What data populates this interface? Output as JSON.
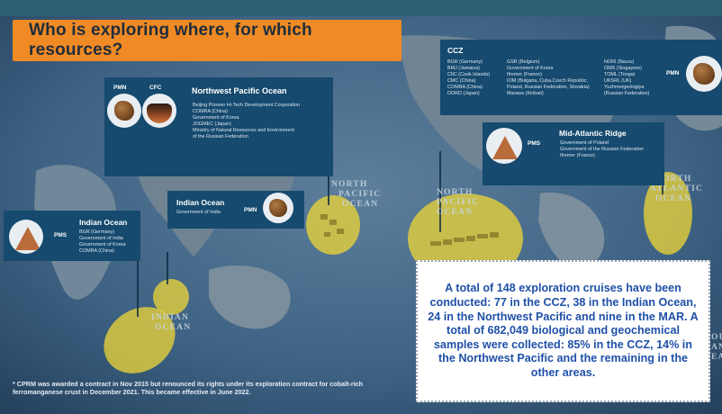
{
  "title": "Who is exploring where, for which resources?",
  "colors": {
    "accent_orange": "#ef8a24",
    "card_blue": "#164a6e",
    "exploration_area_yellow": "#e8d23a",
    "info_text_blue": "#1f50a8"
  },
  "cards": {
    "npo": {
      "title": "Northwest Pacific Ocean",
      "tag1": "PMN",
      "tag2": "CFC",
      "contractors": [
        "Beijing Pioneer Hi-Tech Development Corporation",
        "COMRA (China)",
        "Government of Korea",
        "JOGMEC (Japan)",
        "Ministry of Natural Resources and Environment",
        "of the Russian Federation"
      ]
    },
    "io_left": {
      "title": "Indian Ocean",
      "tag": "PMS",
      "contractors": [
        "BGR (Germany)",
        "Government of India",
        "Government of Korea",
        "COMRA (China)"
      ]
    },
    "io_mid": {
      "title": "Indian Ocean",
      "subtitle": "Government of India",
      "tag": "PMN"
    },
    "ccz": {
      "title": "CCZ",
      "tag": "PMN",
      "col1": [
        "BGR (Germany)",
        "BMJ (Jamaica)",
        "CIIC (Cook Islands)",
        "CMC (China)",
        "COMRA (China)",
        "DORD (Japan)"
      ],
      "col2": [
        "GSR (Belgium)",
        "Government of Korea",
        "Ifremer (France)",
        "IOM (Bulgaria, Cuba,Czech Republic,",
        "Poland, Russian Federation, Slovakia)",
        "Marawa (Kiribati)"
      ],
      "col3": [
        "NORI (Nauru)",
        "OMS (Singapore)",
        "TOML (Tonga)",
        "UKSRL (UK)",
        "Yuzhmorgeologiya",
        "(Russian Federation)"
      ]
    },
    "mar": {
      "title": "Mid-Atlantic Ridge",
      "tag": "PMS",
      "contractors": [
        "Government of Poland",
        "Government of the Russian Federation",
        "Ifremer (France)"
      ]
    }
  },
  "ocean_labels": {
    "north_pacific_center": [
      "NORTH",
      "PACIFIC",
      "OCEAN"
    ],
    "north_pacific_east": [
      "NORTH",
      "PACIFIC",
      "OCEAN"
    ],
    "north_atlantic": [
      "NORTH",
      "ATLANTIC",
      "OCEAN"
    ],
    "indian": [
      "INDIAN",
      "OCEAN"
    ],
    "south_atlantic_edge": [
      "OUT",
      "AN",
      "EA"
    ]
  },
  "summary": "A  total of 148 exploration cruises have been conducted: 77 in the CCZ, 38 in the Indian Ocean, 24 in the Northwest Pacific and nine in the MAR. A total of 682,049 biological and geochemical samples were collected: 85% in the CCZ, 14% in the Northwest Pacific and the remaining in the other areas.",
  "footnote": "* CPRM was awarded a contract in Nov 2015 but renounced its rights under its exploration contract for cobalt-rich ferromanganese crust in December 2021. This became effective in June 2022."
}
